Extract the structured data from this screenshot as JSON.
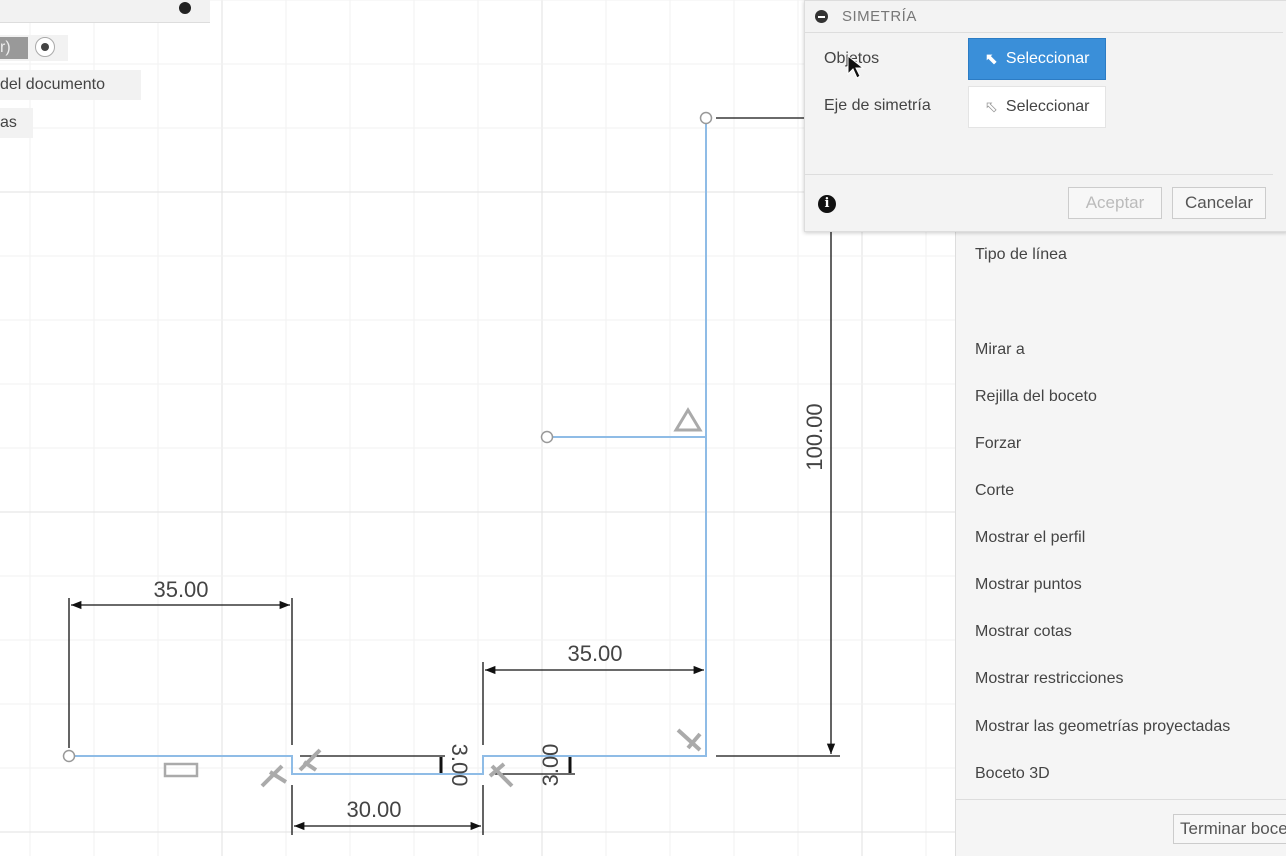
{
  "left_panel": {
    "item_partial_1": "r)",
    "item_partial_2": "del documento",
    "item_partial_3": "as"
  },
  "sketch": {
    "dimensions": {
      "left_width": "35.00",
      "right_width": "35.00",
      "bottom_width": "30.00",
      "height": "100.00",
      "depth_1": "3.00",
      "depth_2": "3.00"
    },
    "line_color": "#8fbce6"
  },
  "dialog": {
    "title": "SIMETRÍA",
    "objects_label": "Objetos",
    "objects_button": "Seleccionar",
    "axis_label": "Eje de simetría",
    "axis_button": "Seleccionar",
    "accept": "Aceptar",
    "cancel": "Cancelar",
    "accent": "#3a8fd9"
  },
  "sketch_palette": {
    "items": [
      "Tipo de línea",
      "Mirar a",
      "Rejilla del boceto",
      "Forzar",
      "Corte",
      "Mostrar el perfil",
      "Mostrar puntos",
      "Mostrar cotas",
      "Mostrar restricciones",
      "Mostrar las geometrías proyectadas",
      "Boceto 3D"
    ],
    "finish_button": "Terminar boceto"
  }
}
